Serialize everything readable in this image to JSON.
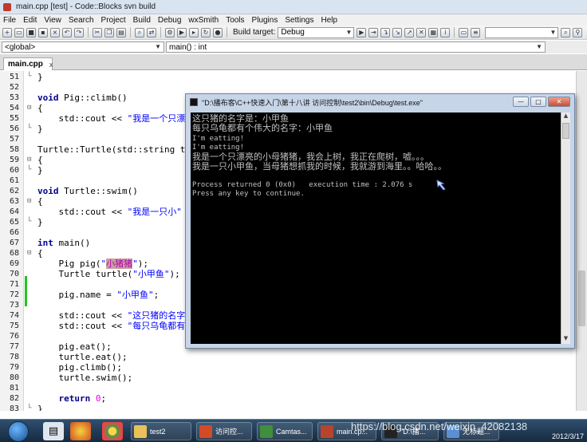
{
  "window": {
    "title": "main.cpp [test] - Code::Blocks svn build"
  },
  "menu": [
    "File",
    "Edit",
    "View",
    "Search",
    "Project",
    "Build",
    "Debug",
    "wxSmith",
    "Tools",
    "Plugins",
    "Settings",
    "Help"
  ],
  "toolbar": {
    "build_target_label": "Build target:",
    "build_target_value": "Debug",
    "search_value": ""
  },
  "scope_bar": {
    "scope": "<global>",
    "function": "main() : int"
  },
  "editor": {
    "tab_label": "main.cpp",
    "tab_close": "x",
    "lines": [
      {
        "n": "51",
        "fold": "└",
        "code": "}"
      },
      {
        "n": "52",
        "fold": "",
        "code": ""
      },
      {
        "n": "53",
        "fold": "",
        "code": "void Pig::climb()"
      },
      {
        "n": "54",
        "fold": "⊟",
        "code": "{"
      },
      {
        "n": "55",
        "fold": "",
        "code": "    std::cout << \"我是一个只漂"
      },
      {
        "n": "56",
        "fold": "└",
        "code": "}"
      },
      {
        "n": "57",
        "fold": "",
        "code": ""
      },
      {
        "n": "58",
        "fold": "",
        "code": "Turtle::Turtle(std::string th"
      },
      {
        "n": "59",
        "fold": "⊟",
        "code": "{"
      },
      {
        "n": "60",
        "fold": "└",
        "code": "}"
      },
      {
        "n": "61",
        "fold": "",
        "code": ""
      },
      {
        "n": "62",
        "fold": "",
        "code": "void Turtle::swim()"
      },
      {
        "n": "63",
        "fold": "⊟",
        "code": "{"
      },
      {
        "n": "64",
        "fold": "",
        "code": "    std::cout << \"我是一只小\""
      },
      {
        "n": "65",
        "fold": "└",
        "code": "}"
      },
      {
        "n": "66",
        "fold": "",
        "code": ""
      },
      {
        "n": "67",
        "fold": "",
        "code": "int main()"
      },
      {
        "n": "68",
        "fold": "⊟",
        "code": "{"
      },
      {
        "n": "69",
        "fold": "",
        "code": "    Pig pig(\"小猪猪\");"
      },
      {
        "n": "70",
        "fold": "",
        "code": "    Turtle turtle(\"小甲鱼\");"
      },
      {
        "n": "71",
        "fold": "",
        "code": ""
      },
      {
        "n": "72",
        "fold": "",
        "code": "    pig.name = \"小甲鱼\";"
      },
      {
        "n": "73",
        "fold": "",
        "code": ""
      },
      {
        "n": "74",
        "fold": "",
        "code": "    std::cout << \"这只猪的名字"
      },
      {
        "n": "75",
        "fold": "",
        "code": "    std::cout << \"每只乌龟都有"
      },
      {
        "n": "76",
        "fold": "",
        "code": ""
      },
      {
        "n": "77",
        "fold": "",
        "code": "    pig.eat();"
      },
      {
        "n": "78",
        "fold": "",
        "code": "    turtle.eat();"
      },
      {
        "n": "79",
        "fold": "",
        "code": "    pig.climb();"
      },
      {
        "n": "80",
        "fold": "",
        "code": "    turtle.swim();"
      },
      {
        "n": "81",
        "fold": "",
        "code": ""
      },
      {
        "n": "82",
        "fold": "",
        "code": "    return 0;"
      },
      {
        "n": "83",
        "fold": "└",
        "code": "}"
      }
    ]
  },
  "console": {
    "title": "\"D:\\播布客\\C++快速入门\\第十八讲 访问控制\\test2\\bin\\Debug\\test.exe\"",
    "lines": [
      "这只猪的名字是：小甲鱼",
      "每只乌龟都有个伟大的名字：小甲鱼",
      "I'm eatting!",
      "I'm eatting!",
      "我是一个只漂亮的小母猪猪，我会上树，我正在爬树，嘘。。。",
      "我是一只小甲鱼，当母猪想抓我的时候，我就游到海里。。哈哈。。",
      "",
      "Process returned 0 (0x0)   execution time : 2.076 s",
      "Press any key to continue."
    ]
  },
  "taskbar": {
    "tasks": [
      {
        "label": "test2",
        "color": "#e8c15a"
      },
      {
        "label": "访问控...",
        "color": "#d24b26"
      },
      {
        "label": "Camtas...",
        "color": "#3f8f3f"
      },
      {
        "label": "main.cp...",
        "color": "#b8442c"
      },
      {
        "label": "\"D:\\播...",
        "color": "#222222"
      },
      {
        "label": "无标题...",
        "color": "#5a8fd0"
      }
    ],
    "date": "2012/3/17",
    "watermark": "https://blog.csdn.net/weixin_42082138"
  }
}
